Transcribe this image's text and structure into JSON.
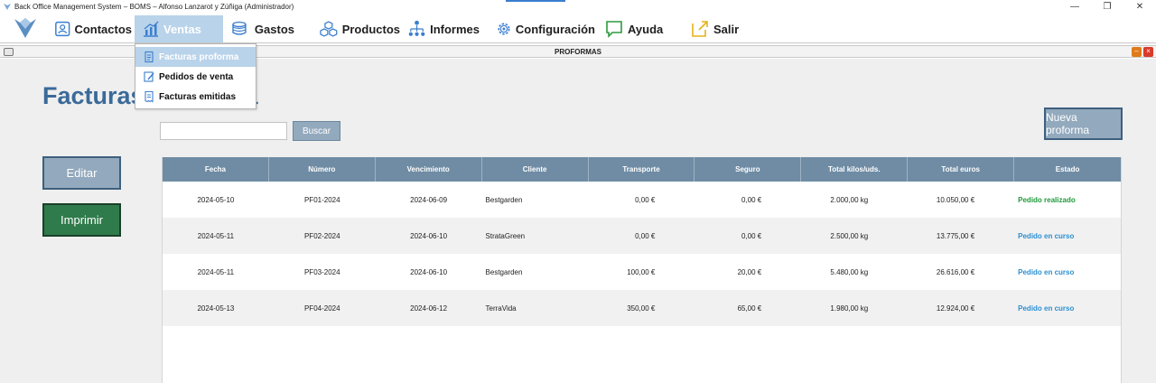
{
  "window": {
    "title": "Back Office Management System – BOMS – Alfonso Lanzarot y Zúñiga (Administrador)",
    "controls": [
      "—",
      "❐",
      "✕"
    ]
  },
  "menu": {
    "items": [
      {
        "label": "Contactos",
        "icon": "contacts-icon"
      },
      {
        "label": "Ventas",
        "icon": "sales-chart-icon",
        "active": true
      },
      {
        "label": "Gastos",
        "icon": "coins-icon"
      },
      {
        "label": "Productos",
        "icon": "cubes-icon"
      },
      {
        "label": "Informes",
        "icon": "org-chart-icon"
      },
      {
        "label": "Configuración",
        "icon": "gear-icon"
      },
      {
        "label": "Ayuda",
        "icon": "chat-icon"
      },
      {
        "label": "Salir",
        "icon": "exit-icon"
      }
    ],
    "dropdown": [
      {
        "label": "Facturas proforma",
        "highlighted": true
      },
      {
        "label": "Pedidos de venta"
      },
      {
        "label": "Facturas emitidas"
      }
    ]
  },
  "inner_window": {
    "title": "PROFORMAS",
    "min": "–",
    "close": "×"
  },
  "page": {
    "title": "Facturas proforma",
    "search_button": "Buscar",
    "search_value": "",
    "new_button": "Nueva proforma",
    "edit_button": "Editar",
    "print_button": "Imprimir"
  },
  "table": {
    "headers": [
      "Fecha",
      "Número",
      "Vencimiento",
      "Cliente",
      "Transporte",
      "Seguro",
      "Total kilos/uds.",
      "Total euros",
      "Estado"
    ],
    "rows": [
      [
        "2024-05-10",
        "PF01-2024",
        "2024-06-09",
        "Bestgarden",
        "0,00 €",
        "0,00 €",
        "2.000,00 kg",
        "10.050,00 €",
        "Pedido realizado"
      ],
      [
        "2024-05-11",
        "PF02-2024",
        "2024-06-10",
        "StrataGreen",
        "0,00 €",
        "0,00 €",
        "2.500,00 kg",
        "13.775,00 €",
        "Pedido en curso"
      ],
      [
        "2024-05-11",
        "PF03-2024",
        "2024-06-10",
        "Bestgarden",
        "100,00 €",
        "20,00 €",
        "5.480,00 kg",
        "26.616,00 €",
        "Pedido en curso"
      ],
      [
        "2024-05-13",
        "PF04-2024",
        "2024-06-12",
        "TerraVida",
        "350,00 €",
        "65,00 €",
        "1.980,00 kg",
        "12.924,00 €",
        "Pedido en curso"
      ]
    ]
  },
  "colors": {
    "status_done": "#1f9a3a",
    "status_progress": "#2b8fd0",
    "header_bg": "#6f8ca4",
    "accent": "#3a6a99"
  }
}
